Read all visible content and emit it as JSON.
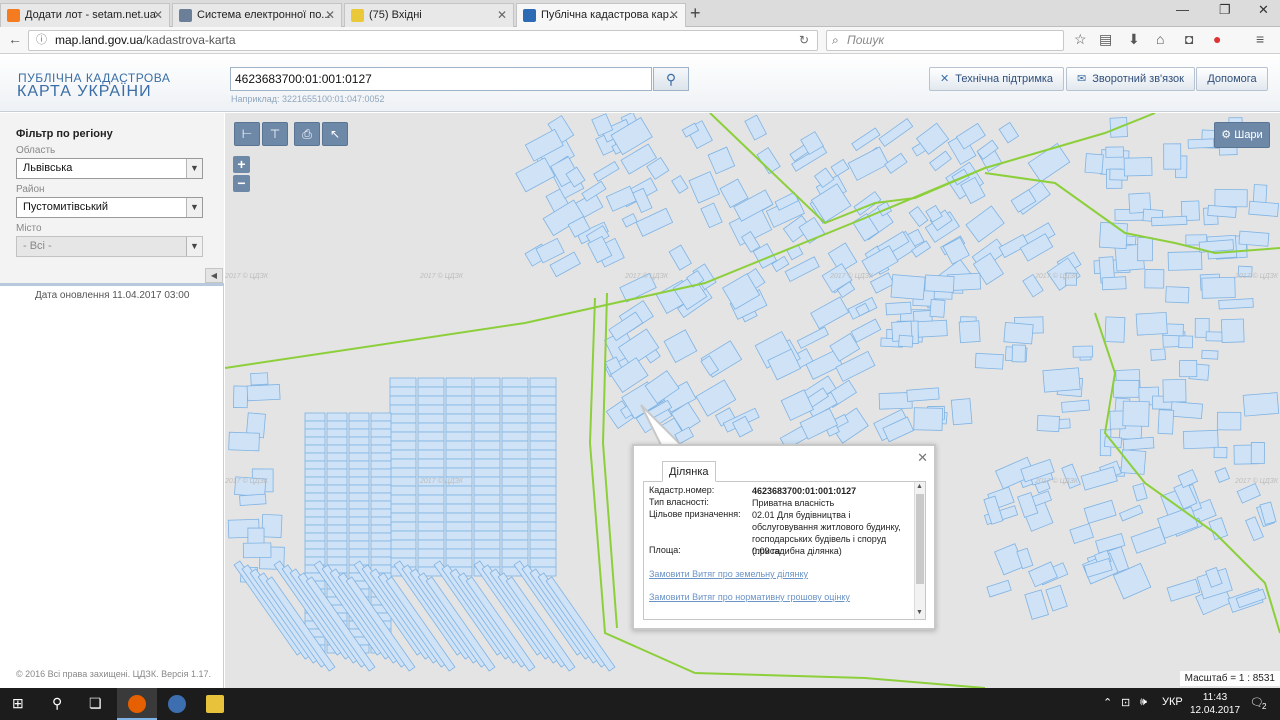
{
  "browser": {
    "tabs": [
      {
        "title": "Додати лот - setam.net.ua",
        "favicon_color": "#f47b20"
      },
      {
        "title": "Система електронної по...",
        "favicon_color": "#6b7f99"
      },
      {
        "title": "(75) Вхідні",
        "favicon_color": "#e9c93a"
      },
      {
        "title": "Публічна кадастрова кар...",
        "favicon_color": "#2d6cb5"
      }
    ],
    "url_host": "map.land.gov.ua",
    "url_path": "/kadastrova-karta",
    "search_placeholder": "Пошук"
  },
  "header": {
    "logo_line1": "ПУБЛІЧНА КАДАСТРОВА",
    "logo_line2": "КАРТА УКРАЇНИ",
    "search_value": "4623683700:01:001:0127",
    "search_hint": "Наприклад: 3221655100:01:047:0052",
    "support_label": "Технічна підтримка",
    "feedback_label": "Зворотний зв'язок",
    "help_label": "Допомога"
  },
  "filter": {
    "title": "Фільтр по регіону",
    "region_label": "Область",
    "region_value": "Львівська",
    "district_label": "Район",
    "district_value": "Пустомитівський",
    "city_label": "Місто",
    "city_value": "- Всі -",
    "update_label": "Дата оновлення  11.04.2017 03:00",
    "copyright": "© 2016 Всі права захищені. ЦДЗК. Версія 1.17."
  },
  "map": {
    "layers_label": "Шари",
    "scale_label": "Масштаб = 1 : 8531",
    "watermark": "2017 © ЦДЗК",
    "parcel_color": "#cfe2f6",
    "parcel_stroke": "#7fb3e3",
    "boundary_color": "#8ccf3a"
  },
  "popup": {
    "tab_label": "Ділянка",
    "cad_key": "Кадастр.номер:",
    "cad_value": "4623683700:01:001:0127",
    "ownership_key": "Тип власності:",
    "ownership_value": "Приватна власність",
    "purpose_key": "Цільове призначення:",
    "purpose_value": "02.01 Для будівництва і обслуговування житлового будинку, господарських будівель і споруд (присадибна ділянка)",
    "area_key": "Площа:",
    "area_value": "0.09 га",
    "link1": "Замовити Витяг про земельну ділянку",
    "link2": "Замовити Витяг про нормативну грошову оцінку"
  },
  "taskbar": {
    "lang": "УКР",
    "time": "11:43",
    "date": "12.04.2017",
    "notif_count": "2"
  }
}
